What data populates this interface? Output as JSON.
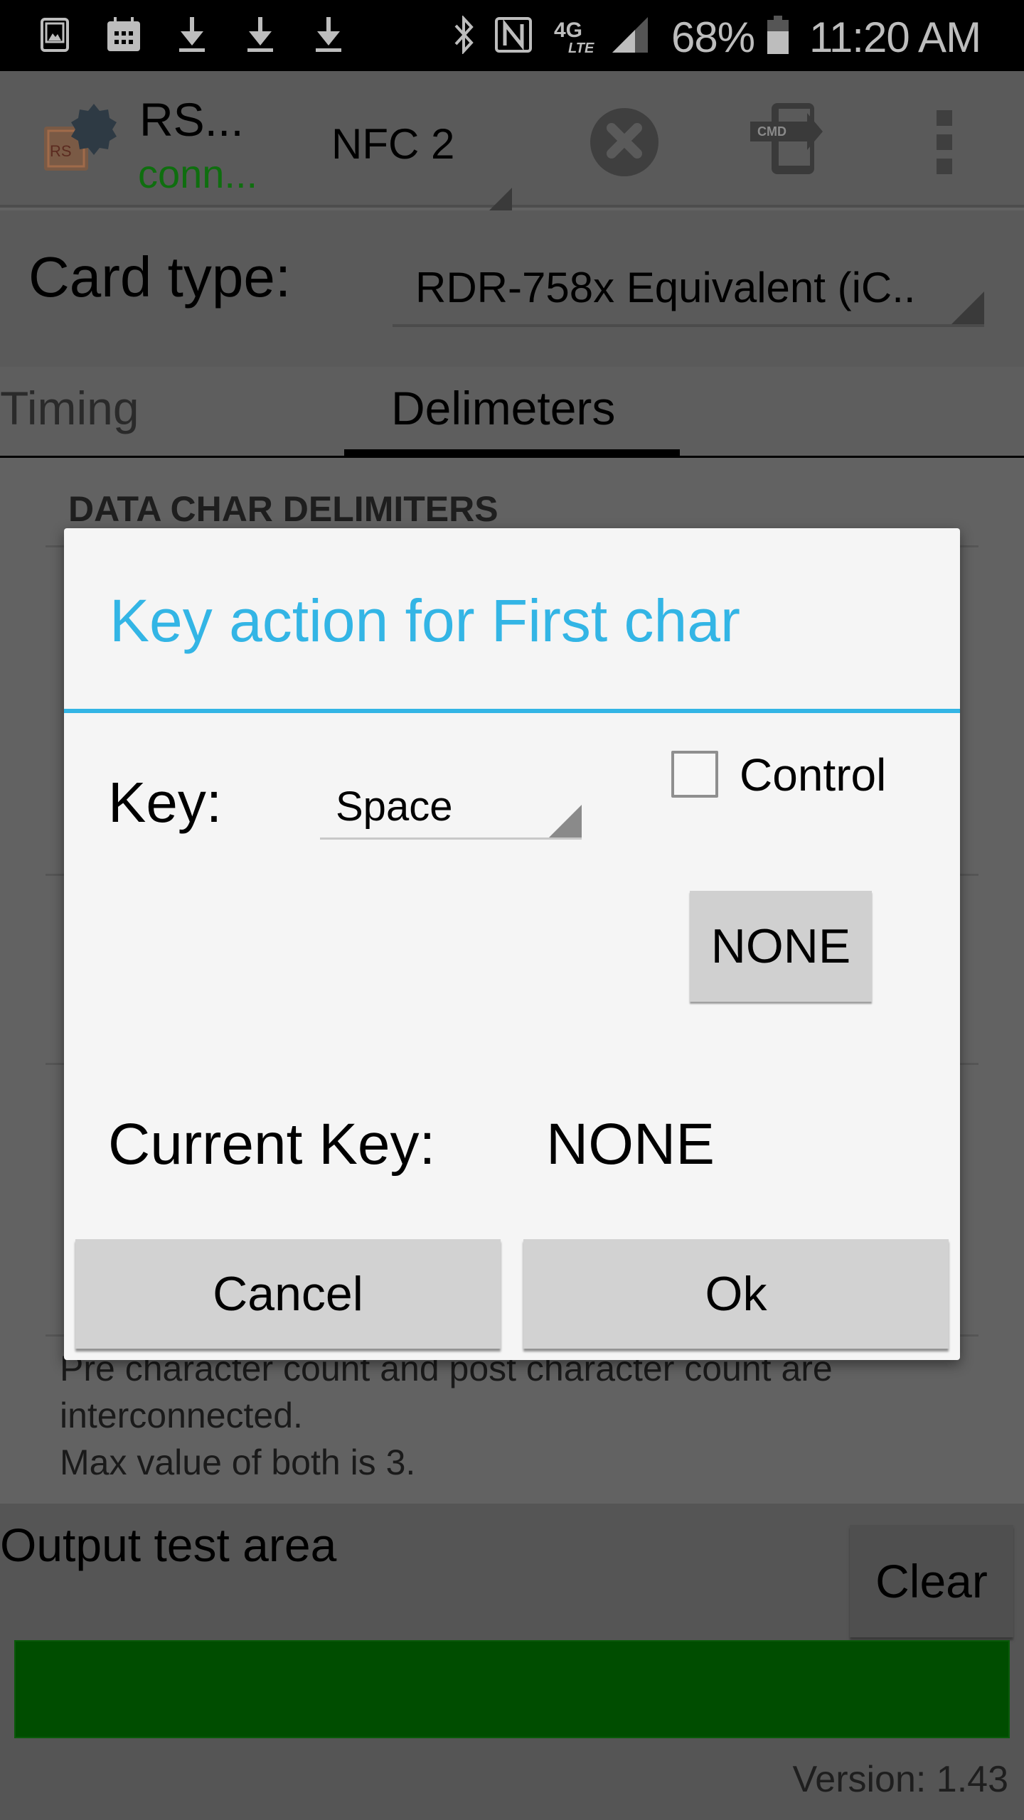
{
  "status_bar": {
    "left_icons": [
      "gallery-icon",
      "calendar-icon",
      "download-icon",
      "download-icon",
      "download-icon"
    ],
    "right_icons": [
      "bluetooth-icon",
      "nfc-icon",
      "4g-lte-icon",
      "signal-icon",
      "battery-icon"
    ],
    "network": "4G LTE",
    "battery": "68%",
    "time": "11:20 AM"
  },
  "toolbar": {
    "app_title": "RS...",
    "connection_status": "conn...",
    "reader_selected": "NFC 2",
    "disconnect_icon": "close-circle-icon",
    "cmd_icon": "cmd-icon",
    "cmd_text": "CMD",
    "overflow_icon": "more-vert-icon"
  },
  "card_type": {
    "label": "Card type:",
    "value": "RDR-758x Equivalent (iC.."
  },
  "tabs": [
    {
      "label": "Timing",
      "active": false
    },
    {
      "label": "Delimeters",
      "active": true
    }
  ],
  "content": {
    "section_title": "DATA CHAR DELIMITERS",
    "note_lines": [
      "Pre character count and post character count are",
      "interconnected.",
      "Max value of both is 3."
    ]
  },
  "bottom": {
    "output_label": "Output test area",
    "clear_label": "Clear",
    "version": "Version: 1.43"
  },
  "dialog": {
    "title": "Key action for First char",
    "key_label": "Key:",
    "key_value": "Space",
    "control_label": "Control",
    "control_checked": false,
    "none_button": "NONE",
    "current_key_label": "Current Key:",
    "current_key_value": "NONE",
    "cancel": "Cancel",
    "ok": "Ok"
  },
  "colors": {
    "accent": "#33b5e5",
    "connected_green": "#0f6e0f",
    "output_area": "#004d00"
  }
}
